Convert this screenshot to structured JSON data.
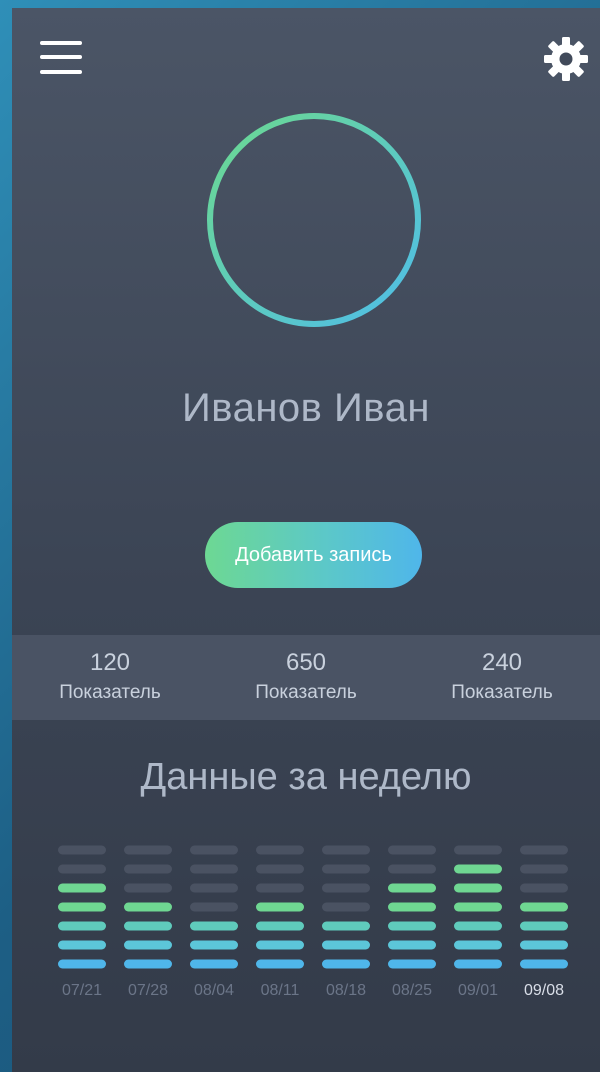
{
  "header": {
    "menu_icon": "hamburger-menu-icon",
    "settings_icon": "gear-icon"
  },
  "profile": {
    "name": "Иванов Иван",
    "ring_colors": [
      "#6cd98f",
      "#4fbde9"
    ]
  },
  "actions": {
    "add_record_label": "Добавить запись"
  },
  "stats": [
    {
      "value": "120",
      "label": "Показатель"
    },
    {
      "value": "650",
      "label": "Показатель"
    },
    {
      "value": "240",
      "label": "Показатель"
    }
  ],
  "weekly": {
    "title": "Данные за неделю",
    "colors": {
      "empty": "#4a5262",
      "green": "#6fd792",
      "teal": "#5fcbbc",
      "aqua": "#5cc6d9",
      "blue": "#4fb6ea"
    },
    "active_index": 7,
    "chart_data": {
      "type": "bar",
      "categories": [
        "07/21",
        "07/28",
        "08/04",
        "08/11",
        "08/18",
        "08/25",
        "09/01",
        "09/08"
      ],
      "values": [
        5,
        4,
        3,
        4,
        3,
        5,
        6,
        4
      ],
      "ylim": [
        0,
        7
      ]
    }
  }
}
